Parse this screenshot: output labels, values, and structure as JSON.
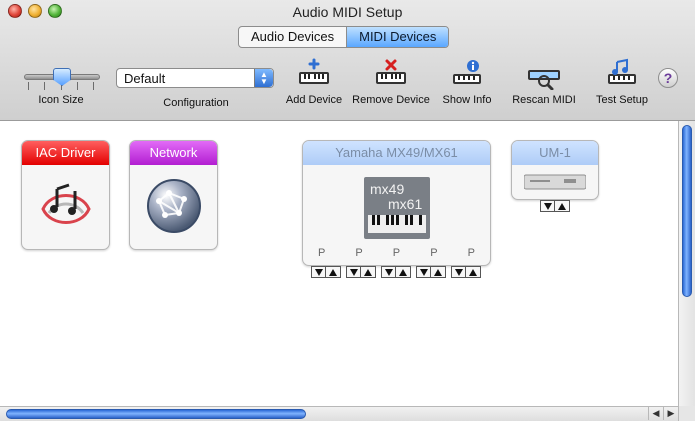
{
  "window": {
    "title": "Audio MIDI Setup"
  },
  "tabs": [
    {
      "label": "Audio Devices",
      "active": false
    },
    {
      "label": "MIDI Devices",
      "active": true
    }
  ],
  "toolbar": {
    "icon_size_label": "Icon Size",
    "configuration_label": "Configuration",
    "configuration_value": "Default",
    "add_device_label": "Add Device",
    "remove_device_label": "Remove Device",
    "show_info_label": "Show Info",
    "rescan_label": "Rescan MIDI",
    "test_setup_label": "Test Setup",
    "help_label": "?"
  },
  "devices": [
    {
      "name": "IAC Driver",
      "header_color": "#e30000"
    },
    {
      "name": "Network",
      "header_color": "#b21ed1"
    },
    {
      "name": "Yamaha MX49/MX61",
      "header_color": "#aeccf7",
      "ports": [
        "P",
        "P",
        "P",
        "P",
        "P"
      ],
      "logo_line1": "mx49",
      "logo_line2": "mx61"
    },
    {
      "name": "UM-1",
      "header_color": "#aeccf7"
    }
  ],
  "colors": {
    "accent_blue": "#5aa7ff",
    "scrollbar_blue": "#2c6ad6"
  }
}
